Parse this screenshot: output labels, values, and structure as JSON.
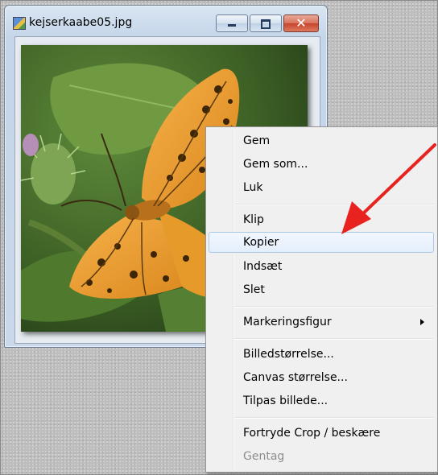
{
  "window": {
    "title": "kejserkaabe05.jpg",
    "minimize_symbol": "",
    "maximize_symbol": "",
    "close_symbol": "✕"
  },
  "photo": {
    "subject": "butterfly"
  },
  "menu": {
    "items": [
      {
        "label": "Gem",
        "enabled": true
      },
      {
        "label": "Gem som...",
        "enabled": true
      },
      {
        "label": "Luk",
        "enabled": true
      },
      {
        "label": "Klip",
        "enabled": true
      },
      {
        "label": "Kopier",
        "enabled": true,
        "highlighted": true
      },
      {
        "label": "Indsæt",
        "enabled": true
      },
      {
        "label": "Slet",
        "enabled": true
      },
      {
        "label": "Markeringsfigur",
        "enabled": true,
        "submenu": true
      },
      {
        "label": "Billedstørrelse...",
        "enabled": true
      },
      {
        "label": "Canvas størrelse...",
        "enabled": true
      },
      {
        "label": "Tilpas billede...",
        "enabled": true
      },
      {
        "label": "Fortryde Crop / beskære",
        "enabled": true
      },
      {
        "label": "Gentag",
        "enabled": false
      }
    ]
  },
  "colors": {
    "annotation_arrow": "#e8231f",
    "highlight_border": "#a8c8ea"
  }
}
